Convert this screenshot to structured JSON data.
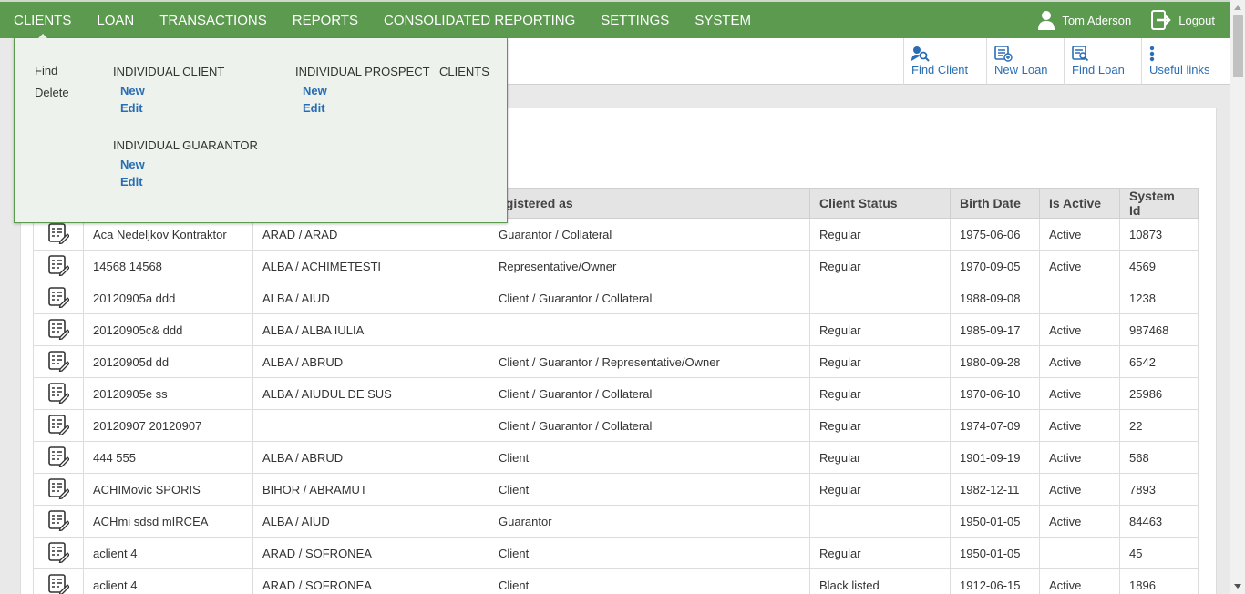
{
  "nav": {
    "items": [
      "CLIENTS",
      "LOAN",
      "TRANSACTIONS",
      "REPORTS",
      "CONSOLIDATED REPORTING",
      "SETTINGS",
      "SYSTEM"
    ],
    "active": "CLIENTS",
    "user_name": "Tom Aderson",
    "logout_label": "Logout",
    "bg_color": "#5c9a4f"
  },
  "quick_links": {
    "find_client": "Find Client",
    "new_loan": "New Loan",
    "find_loan": "Find Loan",
    "useful_links": "Useful links"
  },
  "dropdown": {
    "left_items": [
      "Find",
      "Delete"
    ],
    "individual_client": {
      "heading": "INDIVIDUAL CLIENT",
      "new": "New",
      "edit": "Edit"
    },
    "individual_prospect": {
      "heading": "INDIVIDUAL PROSPECT",
      "new": "New",
      "edit": "Edit"
    },
    "clients_heading": "CLIENTS",
    "individual_guarantor": {
      "heading": "INDIVIDUAL GUARANTOR",
      "new": "New",
      "edit": "Edit"
    }
  },
  "table": {
    "columns": [
      "",
      "",
      "",
      "egistered as",
      "Client Status",
      "Birth Date",
      "Is Active",
      "System Id"
    ],
    "rows": [
      [
        "Aca Nedeljkov Kontraktor",
        "ARAD / ARAD",
        "Guarantor / Collateral",
        "Regular",
        "1975-06-06",
        "Active",
        "10873"
      ],
      [
        "14568 14568",
        "ALBA / ACHIMETESTI",
        "Representative/Owner",
        "Regular",
        "1970-09-05",
        "Active",
        "4569"
      ],
      [
        "20120905a ddd",
        "ALBA / AIUD",
        "Client / Guarantor / Collateral",
        "",
        "1988-09-08",
        "",
        "1238"
      ],
      [
        "20120905c& ddd",
        "ALBA / ALBA IULIA",
        "",
        "Regular",
        "1985-09-17",
        "Active",
        "987468"
      ],
      [
        "20120905d dd",
        "ALBA / ABRUD",
        "Client / Guarantor / Representative/Owner",
        "Regular",
        "1980-09-28",
        "Active",
        "6542"
      ],
      [
        "20120905e ss",
        "ALBA / AIUDUL DE SUS",
        "Client / Guarantor / Collateral",
        "Regular",
        "1970-06-10",
        "Active",
        "25986"
      ],
      [
        "20120907 20120907",
        "",
        "Client / Guarantor / Collateral",
        "Regular",
        "1974-07-09",
        "Active",
        "22"
      ],
      [
        "444 555",
        "ALBA / ABRUD",
        "Client",
        "Regular",
        "1901-09-19",
        "Active",
        "568"
      ],
      [
        "ACHIMovic SPORIS",
        "BIHOR / ABRAMUT",
        "Client",
        "Regular",
        "1982-12-11",
        "Active",
        "7893"
      ],
      [
        "ACHmi sdsd mIRCEA",
        "ALBA / AIUD",
        "Guarantor",
        "",
        "1950-01-05",
        "Active",
        "84463"
      ],
      [
        "aclient 4",
        "ARAD / SOFRONEA",
        "Client",
        "Regular",
        "1950-01-05",
        "",
        "45"
      ],
      [
        "aclient 4",
        "ARAD / SOFRONEA",
        "Client",
        "Black listed",
        "1912-06-15",
        "Active",
        "1896"
      ]
    ]
  }
}
